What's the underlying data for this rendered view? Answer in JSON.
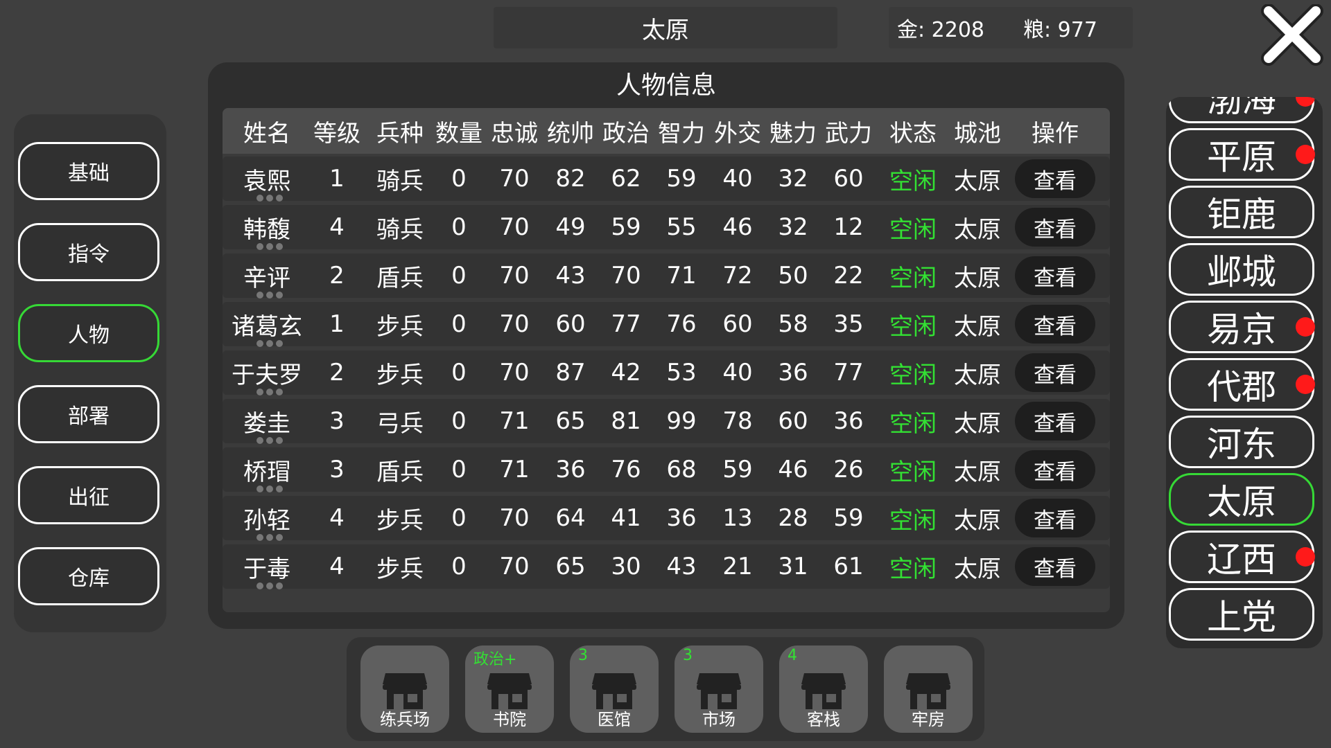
{
  "header": {
    "city": "太原",
    "gold": "金: 2208",
    "grain": "粮: 977"
  },
  "left_menu": [
    "基础",
    "指令",
    "人物",
    "部署",
    "出征",
    "仓库"
  ],
  "left_menu_active": "人物",
  "panel": {
    "title": "人物信息",
    "columns": [
      "姓名",
      "等级",
      "兵种",
      "数量",
      "忠诚",
      "统帅",
      "政治",
      "智力",
      "外交",
      "魅力",
      "武力",
      "状态",
      "城池",
      "操作"
    ],
    "rows": [
      [
        "袁熙",
        "1",
        "骑兵",
        "0",
        "70",
        "82",
        "62",
        "59",
        "40",
        "32",
        "60",
        "空闲",
        "太原",
        "查看"
      ],
      [
        "韩馥",
        "4",
        "骑兵",
        "0",
        "70",
        "49",
        "59",
        "55",
        "46",
        "32",
        "12",
        "空闲",
        "太原",
        "查看"
      ],
      [
        "辛评",
        "2",
        "盾兵",
        "0",
        "70",
        "43",
        "70",
        "71",
        "72",
        "50",
        "22",
        "空闲",
        "太原",
        "查看"
      ],
      [
        "诸葛玄",
        "1",
        "步兵",
        "0",
        "70",
        "60",
        "77",
        "76",
        "60",
        "58",
        "35",
        "空闲",
        "太原",
        "查看"
      ],
      [
        "于夫罗",
        "2",
        "步兵",
        "0",
        "70",
        "87",
        "42",
        "53",
        "40",
        "36",
        "77",
        "空闲",
        "太原",
        "查看"
      ],
      [
        "娄圭",
        "3",
        "弓兵",
        "0",
        "71",
        "65",
        "81",
        "99",
        "78",
        "60",
        "36",
        "空闲",
        "太原",
        "查看"
      ],
      [
        "桥瑁",
        "3",
        "盾兵",
        "0",
        "71",
        "36",
        "76",
        "68",
        "59",
        "46",
        "26",
        "空闲",
        "太原",
        "查看"
      ],
      [
        "孙轻",
        "4",
        "步兵",
        "0",
        "70",
        "64",
        "41",
        "36",
        "13",
        "28",
        "59",
        "空闲",
        "太原",
        "查看"
      ],
      [
        "于毒",
        "4",
        "步兵",
        "0",
        "70",
        "65",
        "30",
        "43",
        "21",
        "31",
        "61",
        "空闲",
        "太原",
        "查看"
      ]
    ]
  },
  "cities": [
    {
      "name": "渤海",
      "alert": true
    },
    {
      "name": "平原",
      "alert": true
    },
    {
      "name": "钜鹿",
      "alert": false
    },
    {
      "name": "邺城",
      "alert": false
    },
    {
      "name": "易京",
      "alert": true
    },
    {
      "name": "代郡",
      "alert": true
    },
    {
      "name": "河东",
      "alert": false
    },
    {
      "name": "太原",
      "alert": false,
      "active": true
    },
    {
      "name": "辽西",
      "alert": true
    },
    {
      "name": "上党",
      "alert": false
    }
  ],
  "buildings": [
    {
      "name": "练兵场",
      "badge": ""
    },
    {
      "name": "书院",
      "badge": "政治+"
    },
    {
      "name": "医馆",
      "badge": "3"
    },
    {
      "name": "市场",
      "badge": "3"
    },
    {
      "name": "客栈",
      "badge": "4"
    },
    {
      "name": "牢房",
      "badge": ""
    }
  ],
  "colors": {
    "accent_green": "#36d936",
    "status_green": "#33e133",
    "alert_red": "#ff1a1a"
  },
  "icons": {
    "close": "close-x-icon",
    "building": "shop-icon"
  }
}
